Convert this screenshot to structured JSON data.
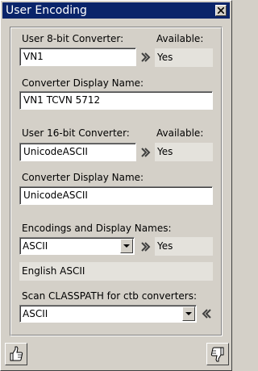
{
  "window": {
    "title": "User Encoding"
  },
  "user8": {
    "label": "User 8-bit Converter:",
    "available_label": "Available:",
    "converter_value": "VN1",
    "available_value": "Yes",
    "display_name_label": "Converter Display Name:",
    "display_name_value": "VN1 TCVN 5712"
  },
  "user16": {
    "label": "User 16-bit Converter:",
    "available_label": "Available:",
    "converter_value": "UnicodeASCII",
    "available_value": "Yes",
    "display_name_label": "Converter Display Name:",
    "display_name_value": "UnicodeASCII"
  },
  "encodings": {
    "label": "Encodings and Display Names:",
    "selected": "ASCII",
    "available_value": "Yes",
    "display_name": "English ASCII"
  },
  "classpath": {
    "label": "Scan CLASSPATH for ctb converters:",
    "selected": "ASCII"
  },
  "icons": {
    "ok": "thumbs-up-icon",
    "cancel": "thumbs-down-icon",
    "close": "close-icon",
    "arrow_right": "chevron-double-right-icon",
    "arrow_left": "chevron-double-left-icon",
    "dropdown": "dropdown-arrow-icon"
  }
}
